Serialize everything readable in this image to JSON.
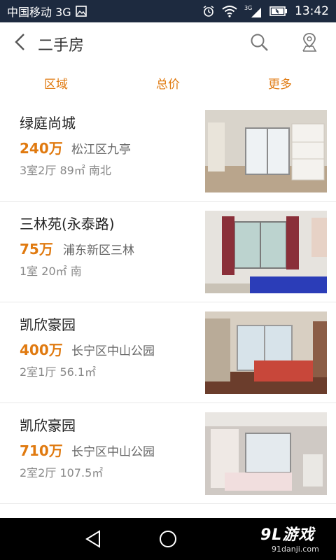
{
  "status_bar": {
    "carrier": "中国移动 3G",
    "time": "13:42"
  },
  "header": {
    "title": "二手房"
  },
  "filters": [
    {
      "label": "区域"
    },
    {
      "label": "总价"
    },
    {
      "label": "更多"
    }
  ],
  "listings": [
    {
      "name": "绿庭尚城",
      "price": "240万",
      "location": "松江区九亭",
      "spec": "3室2厅 89㎡ 南北"
    },
    {
      "name": "三林苑(永泰路)",
      "price": "75万",
      "location": "浦东新区三林",
      "spec": "1室 20㎡ 南"
    },
    {
      "name": "凯欣豪园",
      "price": "400万",
      "location": "长宁区中山公园",
      "spec": "2室1厅 56.1㎡"
    },
    {
      "name": "凯欣豪园",
      "price": "710万",
      "location": "长宁区中山公园",
      "spec": "2室2厅 107.5㎡"
    }
  ],
  "watermark": {
    "logo": "9L游戏",
    "site": "91danji.com"
  },
  "colors": {
    "accent": "#e07a10",
    "status_bar": "#1d2a3f",
    "nav_bar": "#000000"
  },
  "icons": {
    "back": "chevron-left-icon",
    "search": "search-icon",
    "location": "map-pin-icon",
    "nav_back": "triangle-back-icon",
    "nav_home": "circle-home-icon"
  }
}
